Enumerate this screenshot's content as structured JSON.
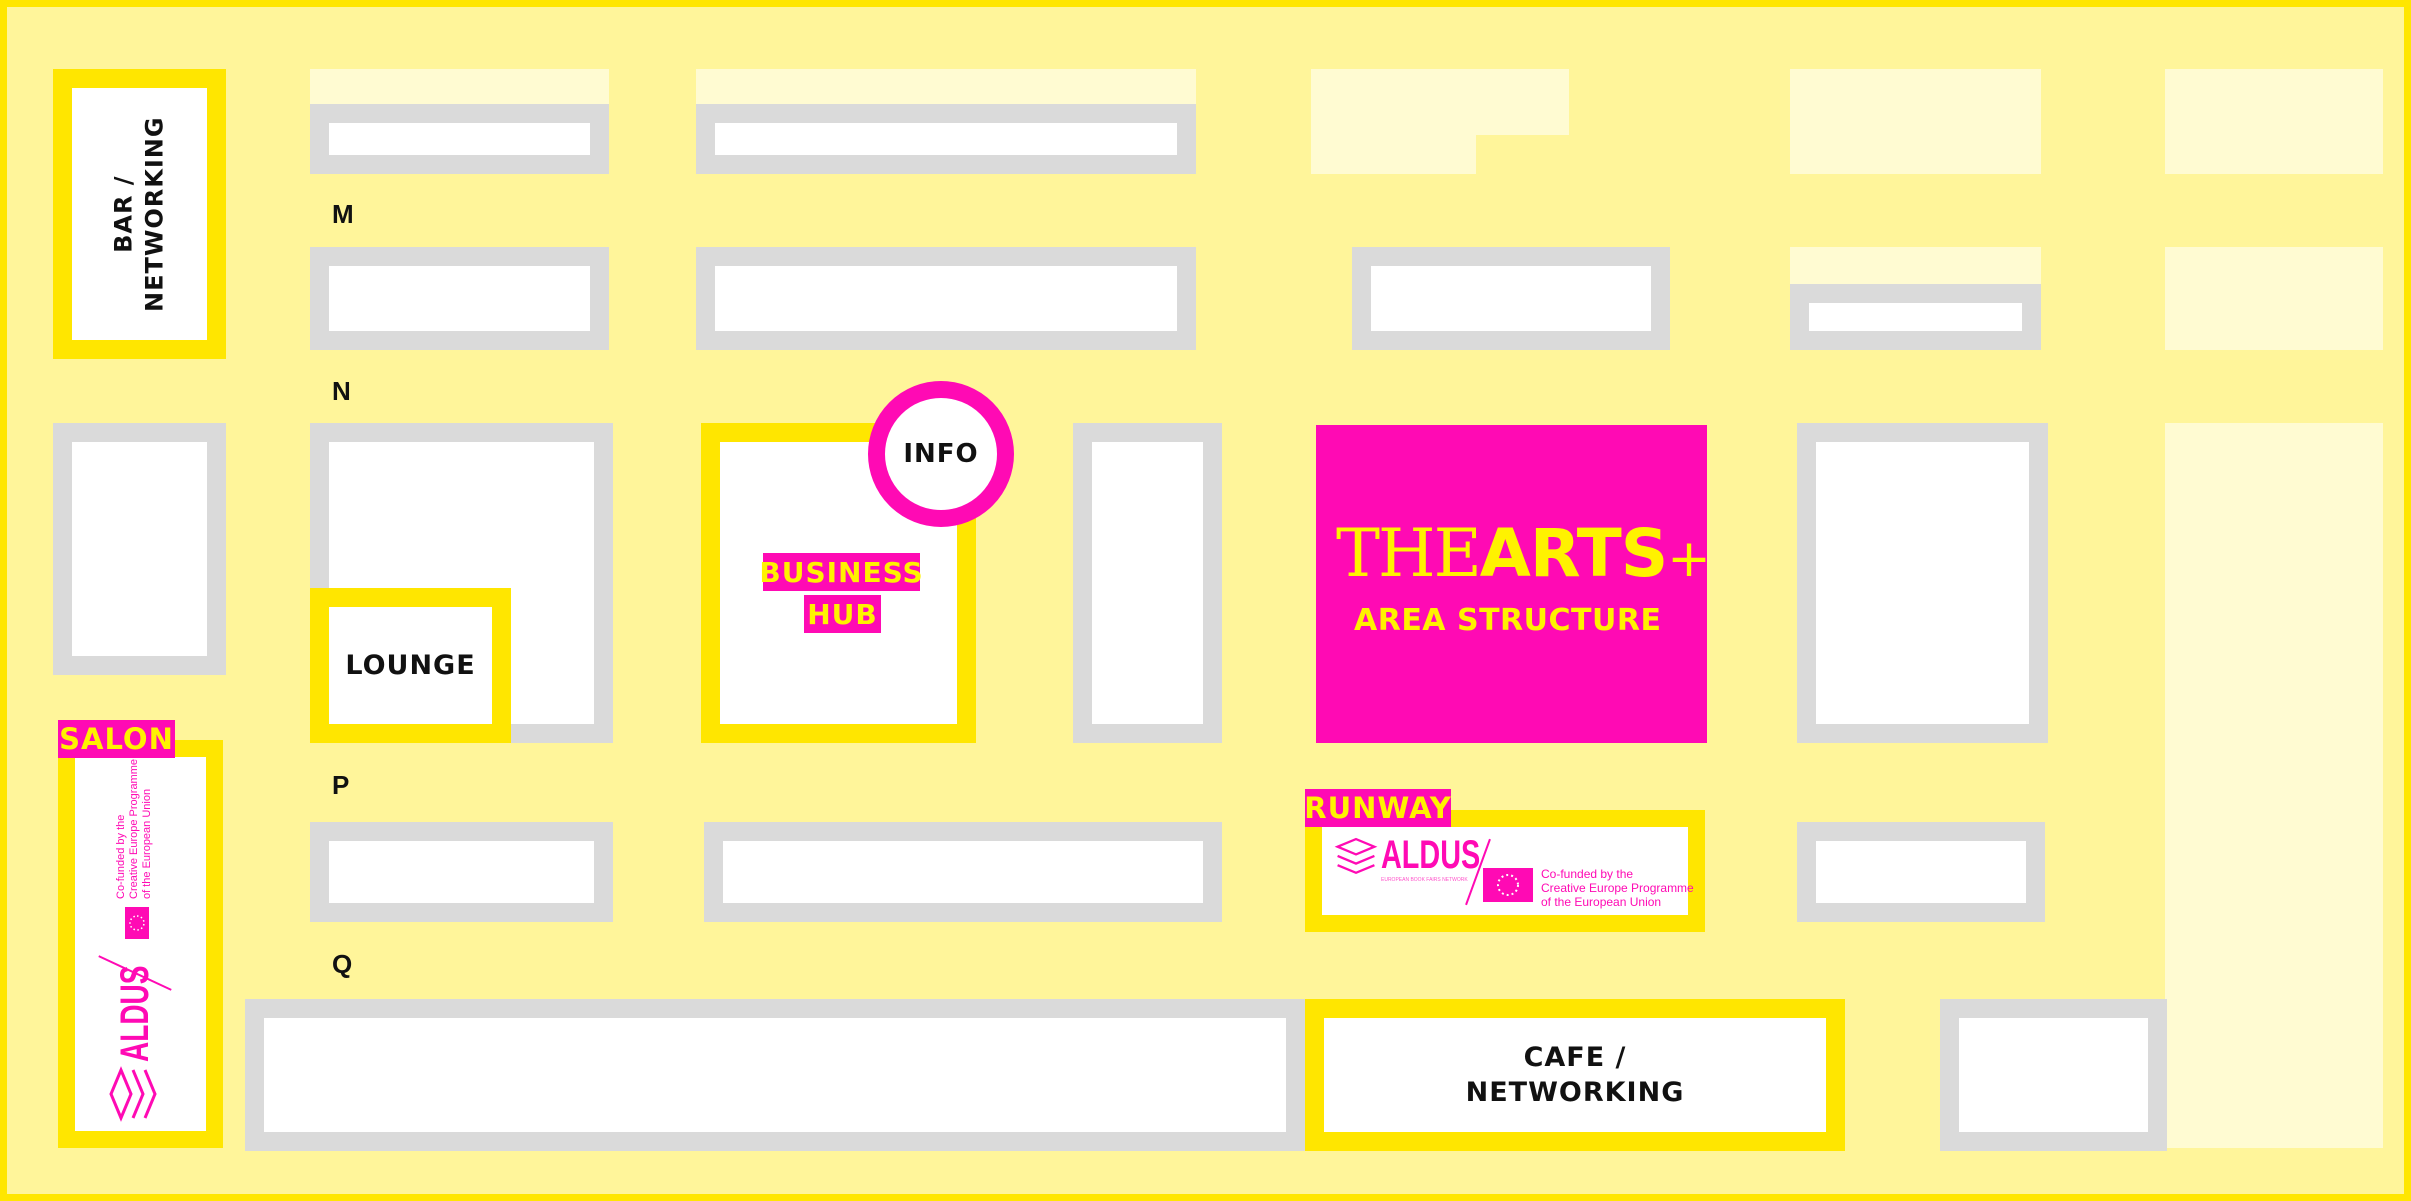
{
  "row_letters": {
    "m": "M",
    "n": "N",
    "p": "P",
    "q": "Q"
  },
  "zones": {
    "bar": "BAR /\nNETWORKING",
    "lounge": "LOUNGE",
    "business_hub_line1": "BUSINESS",
    "business_hub_line2": "HUB",
    "info": "INFO",
    "cafe": "CAFE /\nNETWORKING",
    "salon": "SALON",
    "runway": "RUNWAY"
  },
  "feature": {
    "brand_the": "THE",
    "brand_arts": "ARTS",
    "brand_plus": "+",
    "subtitle": "AREA STRUCTURE"
  },
  "sponsor": {
    "aldus": "ALDUS",
    "aldus_sub": "EUROPEAN BOOK FAIRS NETWORK",
    "eu_line1": "Co-funded by the",
    "eu_line2": "Creative Europe Programme",
    "eu_line3": "of the European Union"
  },
  "colors": {
    "background": "#FFF59A",
    "accent_yellow": "#FFE600",
    "accent_magenta": "#FF0AB4",
    "booth_border": "#DADADA"
  }
}
